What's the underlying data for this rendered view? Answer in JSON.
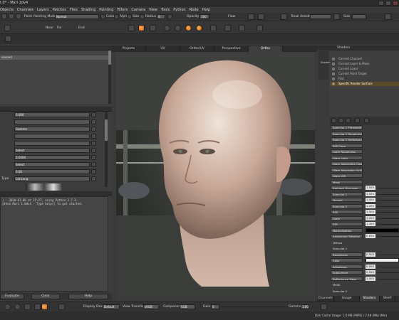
{
  "titlebar": {
    "title": "t.0* - Mari 1dv4"
  },
  "menubar": {
    "items": [
      "Objects",
      "Channels",
      "Layers",
      "Patches",
      "Files",
      "Shading",
      "Painting",
      "Filters",
      "Camera",
      "View",
      "Tools",
      "Python",
      "Node",
      "Help"
    ]
  },
  "toolbar1": {
    "paint_label": "Paint",
    "painting_mode_label": "Painting Mode",
    "painting_mode_value": "Normal",
    "colors_label": "Colors",
    "alpha_label": "Alpha",
    "size_label": "Size",
    "radius_label": "Radius",
    "radius_value": "6",
    "opacity_label": "Opacity",
    "opacity_value": "100",
    "flow_label": "Flow",
    "tonal_density_label": "Tonal density",
    "size2_label": "Size"
  },
  "toolbar2": {
    "near_label": "Near",
    "far_label": "Far",
    "end_label": "End"
  },
  "viewport": {
    "tabs": [
      "Projects",
      "UV",
      "Ortho/UV",
      "Perspective",
      "Ortho"
    ],
    "active_tab": "Ortho"
  },
  "left_panel": {
    "tree_rows": [
      "",
      "ooooed",
      "",
      "",
      "",
      "",
      "",
      ""
    ],
    "prop_rows": [
      {
        "label": "",
        "value": "0.000"
      },
      {
        "label": "",
        "value": ""
      },
      {
        "label": "",
        "value": "Gamma"
      },
      {
        "label": "",
        "value": ""
      },
      {
        "label": "",
        "value": ""
      },
      {
        "label": "",
        "value": "Select"
      },
      {
        "label": "",
        "value": "0.0000"
      },
      {
        "label": "",
        "value": "Select"
      },
      {
        "label": "",
        "value": "0.00"
      },
      {
        "label": "Type",
        "value": "Lat-Long"
      }
    ],
    "console_lines": [
      "] - 2010-07-09 at 15:27, using Python 2.7.3.",
      "ython Mari 1.0dv4 - Type help() to get started.",
      ""
    ],
    "buttons": [
      "Evaluate",
      "Clear",
      "Help"
    ]
  },
  "right_panel": {
    "header": "Shaders",
    "vtab": "Shaders",
    "shader_list": [
      "Current Channel",
      "Current Layer & Mask",
      "Current Layer",
      "Current Paint Target",
      "Flat",
      "Specific Render Surface"
    ],
    "selected_shader": "Specific Render Surface",
    "properties": [
      {
        "name": "Specular 1 Threshold",
        "kind": "header"
      },
      {
        "name": "Specular 2 Roughness",
        "kind": "header"
      },
      {
        "name": "Specular 2 Reflectance Mask",
        "kind": "header"
      },
      {
        "name": "SSS Color",
        "kind": "header"
      },
      {
        "name": "Glare Roughness",
        "kind": "header"
      },
      {
        "name": "Glare Color",
        "kind": "header"
      },
      {
        "name": "Glare Absorption Color",
        "kind": "header"
      },
      {
        "name": "Glare Absorption Scale",
        "kind": "header"
      },
      {
        "name": "Glare IOR",
        "kind": "header"
      },
      {
        "name": "Mask",
        "kind": "header"
      },
      {
        "name": "Ambient Occlusion",
        "kind": "value",
        "value": "1.000"
      },
      {
        "name": "Specular 1",
        "kind": "value",
        "value": "1.000"
      },
      {
        "name": "Fresnel",
        "kind": "value",
        "value": "1.000"
      },
      {
        "name": "Specular 2",
        "kind": "value",
        "value": "1.000"
      },
      {
        "name": "SSS",
        "kind": "value",
        "value": "1.000"
      },
      {
        "name": "Glare",
        "kind": "value",
        "value": "1.000"
      },
      {
        "name": "IOR",
        "kind": "value",
        "value": "1.400"
      },
      {
        "name": "Normalization",
        "kind": "swatch",
        "swatch": "black"
      },
      {
        "name": "Anisotropic Rotation",
        "kind": "value",
        "value": "0.000"
      },
      {
        "name": "Diffuse",
        "kind": "sub"
      },
      {
        "name": "Specular 1",
        "kind": "sub"
      },
      {
        "name": "Roughness",
        "kind": "value",
        "value": "0.500"
      },
      {
        "name": "Color",
        "kind": "swatch",
        "swatch": "white"
      },
      {
        "name": "Anisotropy",
        "kind": "value",
        "value": "0.000"
      },
      {
        "name": "Subsurface",
        "kind": "value",
        "value": "0.500"
      },
      {
        "name": "Reflectance Mask",
        "kind": "value",
        "value": "1.000"
      },
      {
        "name": "Metal",
        "kind": "sub"
      },
      {
        "name": "Specular 2",
        "kind": "sub"
      }
    ],
    "bottom_tabs": [
      "Channels",
      "Image Manager",
      "Shaders",
      "Shelf"
    ]
  },
  "bottombar": {
    "display_device_label": "Display Device",
    "display_device_value": "Default",
    "view_transform_label": "View Transform",
    "view_transform_value": "sRGB",
    "component_label": "Component",
    "component_value": "RGB",
    "gain_label": "Gain",
    "gain_value": "0",
    "gamma_label": "Gamma",
    "gamma_value": "1.00"
  },
  "statusbar": {
    "text": "Disk Cache Usage: 1.0 MB (MIPS) / 2.48 (Mb) (Min)"
  }
}
